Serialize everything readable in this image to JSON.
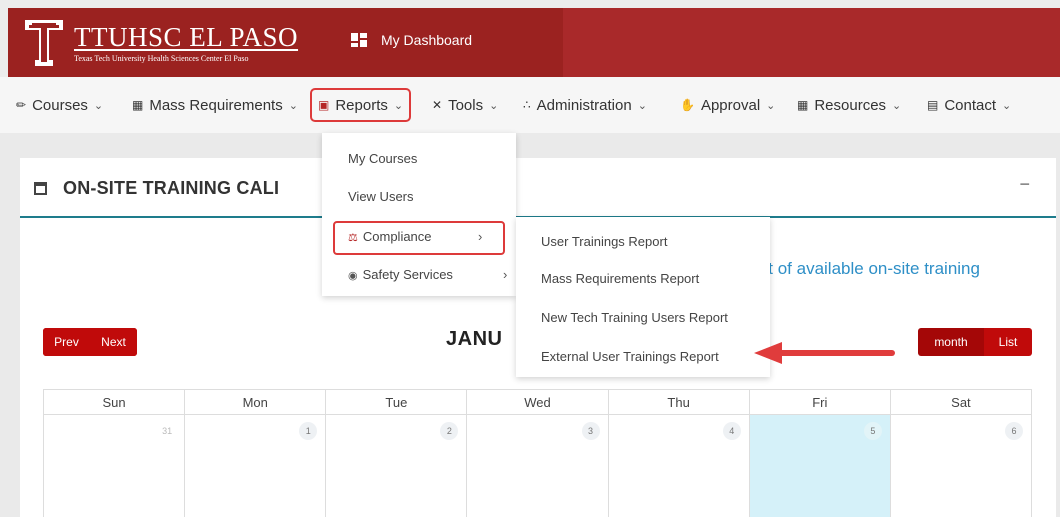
{
  "header": {
    "brand_main": "TTUHSC EL PASO",
    "brand_sub": "Texas Tech University Health Sciences Center El Paso",
    "dashboard_label": "My Dashboard",
    "brand_color": "#9b2220"
  },
  "nav": {
    "items": [
      {
        "label": "Courses",
        "icon": "book-icon"
      },
      {
        "label": "Mass Requirements",
        "icon": "list-icon"
      },
      {
        "label": "Reports",
        "icon": "presentation-icon"
      },
      {
        "label": "Tools",
        "icon": "tools-icon"
      },
      {
        "label": "Administration",
        "icon": "users-icon"
      },
      {
        "label": "Approval",
        "icon": "thumbs-icon"
      },
      {
        "label": "Resources",
        "icon": "books-icon"
      },
      {
        "label": "Contact",
        "icon": "card-icon"
      }
    ]
  },
  "reports_menu": {
    "items": [
      "My Courses",
      "View Users",
      "Compliance",
      "Safety Services"
    ]
  },
  "compliance_menu": {
    "items": [
      "User Trainings Report",
      "Mass Requirements Report",
      "New Tech Training Users Report",
      "External User Trainings Report"
    ]
  },
  "panel": {
    "title": "ON-SITE TRAINING CALI",
    "collapse": "−",
    "info_link": "ist of available on-site training"
  },
  "calendar": {
    "prev": "Prev",
    "next": "Next",
    "month_label": "JANU",
    "month_btn": "month",
    "list_btn": "List",
    "days": [
      "Sun",
      "Mon",
      "Tue",
      "Wed",
      "Thu",
      "Fri",
      "Sat"
    ],
    "dates": [
      "31",
      "1",
      "2",
      "3",
      "4",
      "5",
      "6"
    ],
    "highlight_color": "#d5f1f9"
  }
}
